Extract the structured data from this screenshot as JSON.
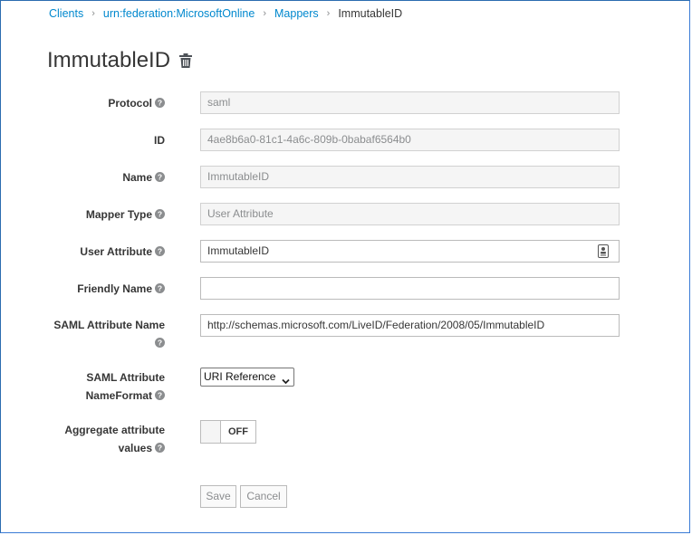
{
  "breadcrumb": {
    "items": [
      "Clients",
      "urn:federation:MicrosoftOnline",
      "Mappers"
    ],
    "current": "ImmutableID"
  },
  "page": {
    "title": "ImmutableID"
  },
  "form": {
    "protocol": {
      "label": "Protocol",
      "value": "saml"
    },
    "id": {
      "label": "ID",
      "value": "4ae8b6a0-81c1-4a6c-809b-0babaf6564b0"
    },
    "name": {
      "label": "Name",
      "value": "ImmutableID"
    },
    "mapper_type": {
      "label": "Mapper Type",
      "value": "User Attribute"
    },
    "user_attribute": {
      "label": "User Attribute",
      "value": "ImmutableID"
    },
    "friendly_name": {
      "label": "Friendly Name",
      "value": ""
    },
    "saml_attribute_name": {
      "label_line1": "SAML Attribute Name",
      "value": "http://schemas.microsoft.com/LiveID/Federation/2008/05/ImmutableID"
    },
    "saml_attribute_nameformat": {
      "label_line1": "SAML Attribute",
      "label_line2": "NameFormat",
      "value": "URI Reference"
    },
    "aggregate": {
      "label_line1": "Aggregate attribute",
      "label_line2": "values",
      "state": "OFF"
    }
  },
  "actions": {
    "save_label": "Save",
    "cancel_label": "Cancel"
  },
  "colors": {
    "link": "#0088ce",
    "text": "#363636",
    "muted": "#8b8d8f",
    "readonly_bg": "#f5f5f5"
  }
}
